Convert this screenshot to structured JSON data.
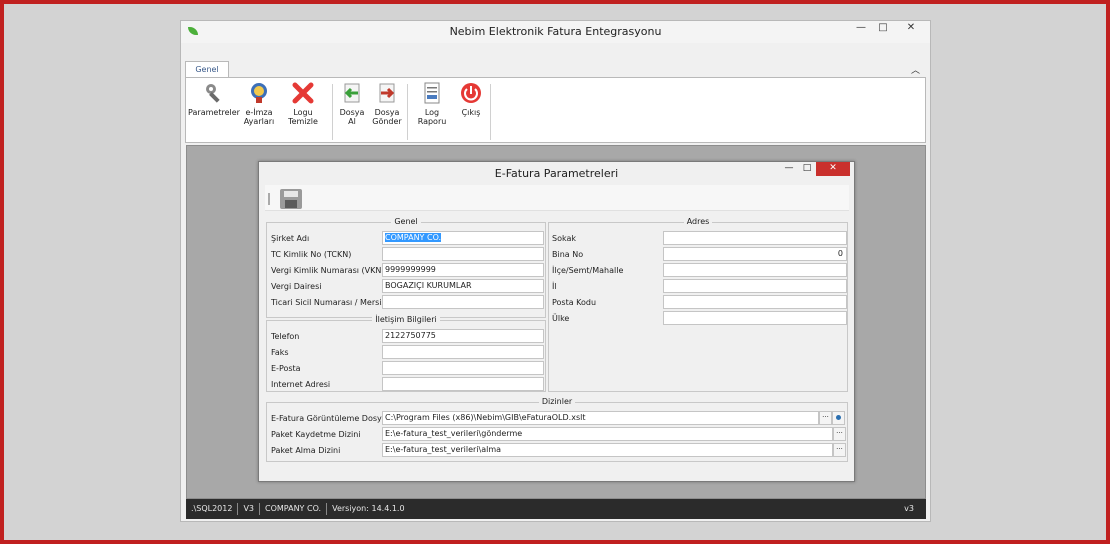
{
  "window": {
    "title": "Nebim Elektronik Fatura Entegrasyonu",
    "controls": [
      "—",
      "□",
      "✕"
    ]
  },
  "ribbon": {
    "tab": "Genel",
    "collapse_glyph": "︿",
    "buttons": {
      "parametreler": "Parametreler",
      "eimza_line1": "e-İmza",
      "eimza_line2": "Ayarları",
      "logu_temizle": "Logu Temizle",
      "dosya_al_line1": "Dosya",
      "dosya_al_line2": "Al",
      "dosya_gonder_line1": "Dosya",
      "dosya_gonder_line2": "Gönder",
      "log_raporu": "Log Raporu",
      "cikis": "Çıkış"
    }
  },
  "dialog": {
    "title": "E-Fatura Parametreleri",
    "controls": [
      "—",
      "□",
      "✕"
    ],
    "genel": {
      "title": "Genel",
      "sirket_adi_label": "Şirket Adı",
      "sirket_adi_value": "COMPANY CO.",
      "tckn_label": "TC Kimlik No (TCKN)",
      "tckn_value": "",
      "vkn_label": "Vergi Kimlik Numarası (VKN)",
      "vkn_value": "9999999999",
      "vergi_dairesi_label": "Vergi Dairesi",
      "vergi_dairesi_value": "BOGAZIÇI KURUMLAR",
      "ticari_sicil_label": "Ticari Sicil Numarası / Mersis No",
      "ticari_sicil_value": ""
    },
    "iletisim": {
      "title": "İletişim Bilgileri",
      "telefon_label": "Telefon",
      "telefon_value": "2122750775",
      "faks_label": "Faks",
      "faks_value": "",
      "eposta_label": "E-Posta",
      "eposta_value": "",
      "internet_label": "Internet Adresi",
      "internet_value": ""
    },
    "adres": {
      "title": "Adres",
      "sokak_label": "Sokak",
      "sokak_value": "",
      "bina_no_label": "Bina No",
      "bina_no_value": "0",
      "ilce_label": "İlçe/Semt/Mahalle",
      "ilce_value": "",
      "il_label": "İl",
      "il_value": "",
      "posta_kodu_label": "Posta Kodu",
      "posta_kodu_value": "",
      "ulke_label": "Ülke",
      "ulke_value": ""
    },
    "dizinler": {
      "title": "Dizinler",
      "goruntuleme_label": "E-Fatura Görüntüleme Dosyası",
      "goruntuleme_value": "C:\\Program Files (x86)\\Nebim\\GIB\\eFaturaOLD.xslt",
      "paket_kaydetme_label": "Paket Kaydetme Dizini",
      "paket_kaydetme_value": "E:\\e-fatura_test_verileri\\gönderme",
      "paket_alma_label": "Paket Alma Dizini",
      "paket_alma_value": "E:\\e-fatura_test_verileri\\alma",
      "browse_glyph": "···"
    }
  },
  "statusbar": {
    "server": ".\\SQL2012",
    "version_short": "V3",
    "company": "COMPANY CO.",
    "version": "Versiyon: 14.4.1.0",
    "right": "v3"
  }
}
